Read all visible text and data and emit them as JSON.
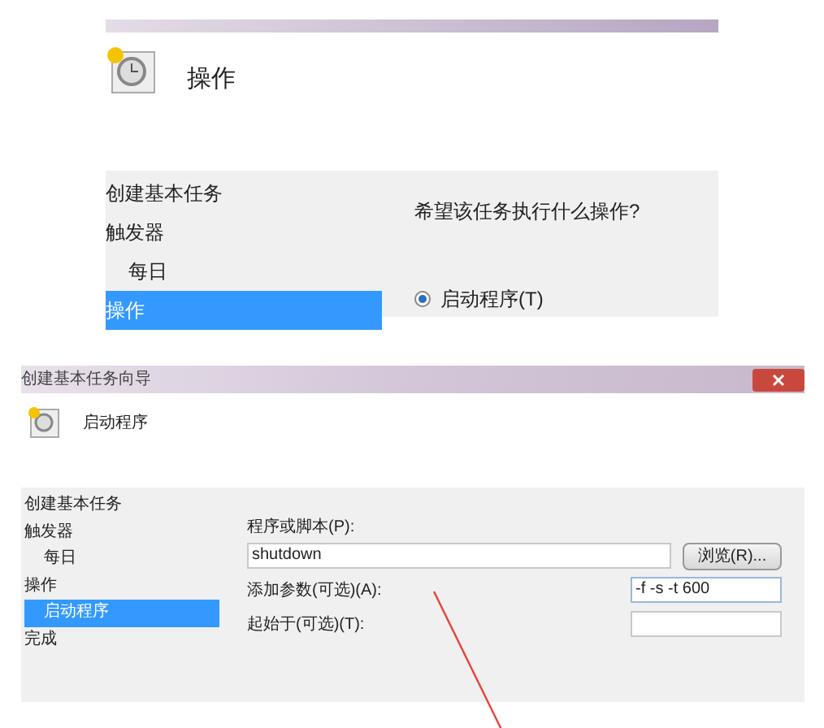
{
  "top_panel": {
    "heading": "操作",
    "nav": [
      {
        "label": "创建基本任务",
        "selected": false
      },
      {
        "label": "触发器",
        "selected": false,
        "children": [
          {
            "label": "每日",
            "selected": false
          }
        ]
      },
      {
        "label": "操作",
        "selected": true
      }
    ],
    "question": "希望该任务执行什么操作?",
    "options": [
      {
        "label": "启动程序(T)",
        "selected": true
      }
    ]
  },
  "bottom_panel": {
    "window_title": "创建基本任务向导",
    "heading": "启动程序",
    "nav": [
      {
        "label": "创建基本任务",
        "selected": false
      },
      {
        "label": "触发器",
        "selected": false,
        "children": [
          {
            "label": "每日",
            "selected": false
          }
        ]
      },
      {
        "label": "操作",
        "selected": false,
        "children": [
          {
            "label": "启动程序",
            "selected": true
          }
        ]
      },
      {
        "label": "完成",
        "selected": false
      }
    ],
    "program_label": "程序或脚本(P):",
    "program_value": "shutdown",
    "browse_button": "浏览(R)...",
    "arguments_label": "添加参数(可选)(A):",
    "arguments_value": "-f -s -t 600",
    "start_in_label": "起始于(可选)(T):"
  }
}
